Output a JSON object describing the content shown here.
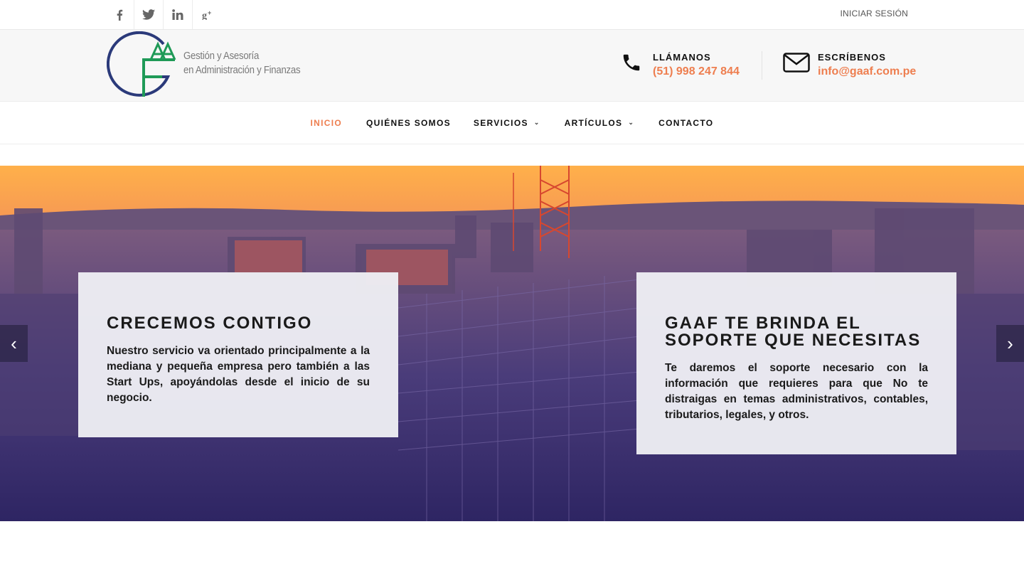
{
  "topbar": {
    "social": [
      {
        "name": "facebook-icon",
        "glyph": "f"
      },
      {
        "name": "twitter-icon",
        "glyph": "t"
      },
      {
        "name": "linkedin-icon",
        "glyph": "in"
      },
      {
        "name": "google-plus-icon",
        "glyph": "g+"
      }
    ],
    "login": "INICIAR SESIÓN"
  },
  "header": {
    "logo_line1": "Gestión y Asesoría",
    "logo_line2": "en Administración y Finanzas",
    "phone_label": "LLÁMANOS",
    "phone_value": "(51) 998 247 844",
    "mail_label": "ESCRÍBENOS",
    "mail_value": "info@gaaf.com.pe",
    "accent": "#ee7e4f"
  },
  "nav": {
    "items": [
      {
        "label": "INICIO",
        "active": true
      },
      {
        "label": "QUIÉNES SOMOS"
      },
      {
        "label": "SERVICIOS",
        "dropdown": true
      },
      {
        "label": "ARTÍCULOS",
        "dropdown": true
      },
      {
        "label": "CONTACTO"
      }
    ]
  },
  "hero": {
    "card1": {
      "title": "CRECEMOS CONTIGO",
      "text": "Nuestro servicio va orientado principalmente a la mediana y pequeña empresa pero también a las Start Ups, apoyándolas desde el inicio de su negocio."
    },
    "card2": {
      "title_line1": "GAAF TE BRINDA EL",
      "title_line2": "SOPORTE QUE NECESITAS",
      "text": "Te daremos el soporte necesario con la información que requieres para que No te distraigas en temas administrativos, contables, tributarios, legales, y otros."
    }
  }
}
